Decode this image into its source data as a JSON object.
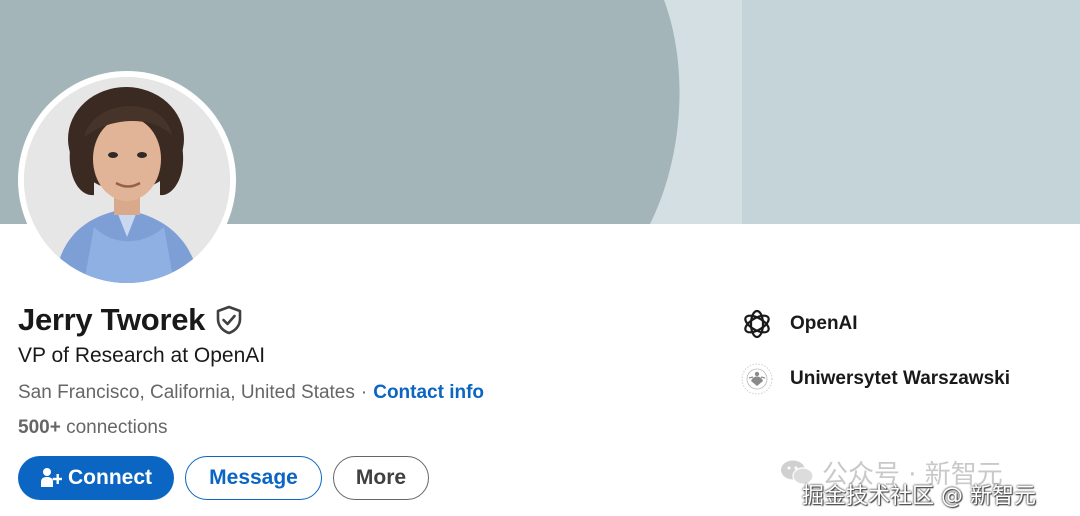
{
  "profile": {
    "name": "Jerry Tworek",
    "headline": "VP of Research at OpenAI",
    "location": "San Francisco, California, United States",
    "separator": "·",
    "contact_label": "Contact info",
    "connections_count": "500+",
    "connections_label": "connections"
  },
  "actions": {
    "connect_label": "Connect",
    "message_label": "Message",
    "more_label": "More"
  },
  "organizations": [
    {
      "name": "OpenAI",
      "icon": "openai-logo"
    },
    {
      "name": "Uniwersytet Warszawski",
      "icon": "university-seal"
    }
  ],
  "watermark": {
    "line1": "公众号 · 新智元",
    "line2": "掘金技术社区 @ 新智元",
    "icon": "wechat-icon"
  },
  "colors": {
    "brand_blue": "#0a66c2",
    "cover_main": "#a3b5b9",
    "cover_light": "#d3dfe2",
    "cover_right": "#c4d4d9"
  }
}
